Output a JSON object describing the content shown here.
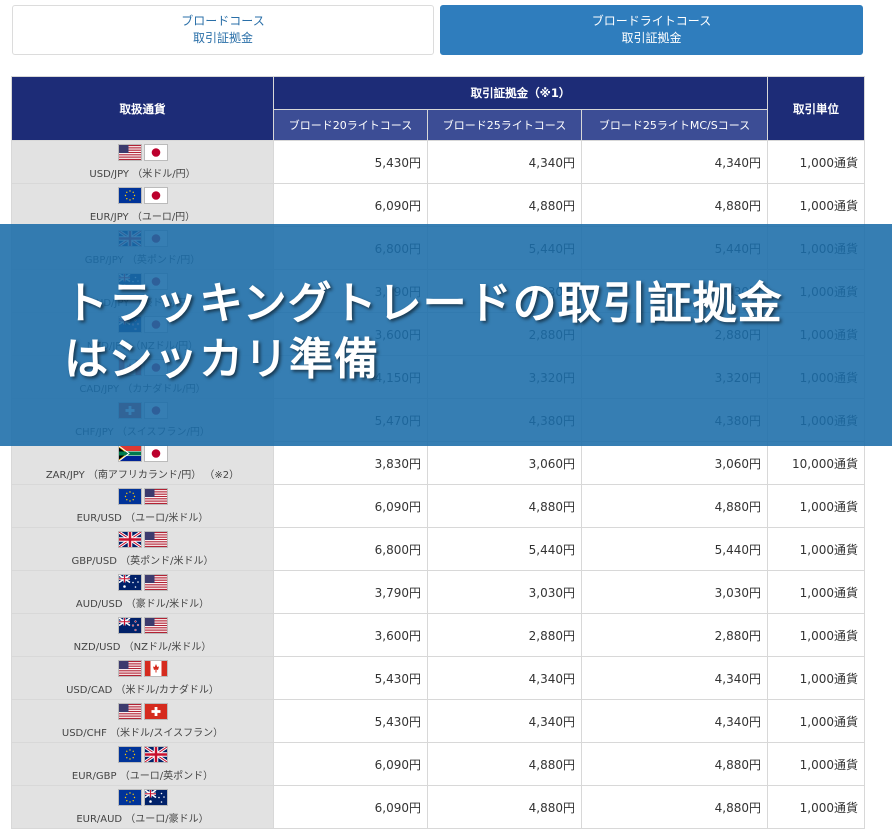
{
  "tabs": [
    {
      "line1": "ブロードコース",
      "line2": "取引証拠金",
      "active": false
    },
    {
      "line1": "ブロードライトコース",
      "line2": "取引証拠金",
      "active": true
    }
  ],
  "table": {
    "col_pair": "取扱通貨",
    "col_margin": "取引証拠金（※1）",
    "col_unit": "取引単位",
    "sub_cols": [
      "ブロード20ライトコース",
      "ブロード25ライトコース",
      "ブロード25ライトMC/Sコース"
    ],
    "rows": [
      {
        "flags": [
          "us",
          "jp"
        ],
        "label": "USD/JPY （米ドル/円）",
        "v1": "5,430円",
        "v2": "4,340円",
        "v3": "4,340円",
        "unit": "1,000通貨"
      },
      {
        "flags": [
          "eu",
          "jp"
        ],
        "label": "EUR/JPY （ユーロ/円）",
        "v1": "6,090円",
        "v2": "4,880円",
        "v3": "4,880円",
        "unit": "1,000通貨"
      },
      {
        "flags": [
          "gb",
          "jp"
        ],
        "label": "GBP/JPY （英ポンド/円）",
        "v1": "6,800円",
        "v2": "5,440円",
        "v3": "5,440円",
        "unit": "1,000通貨"
      },
      {
        "flags": [
          "au",
          "jp"
        ],
        "label": "AUD/JPY （豪ドル/円）",
        "v1": "3,790円",
        "v2": "3,030円",
        "v3": "3,030円",
        "unit": "1,000通貨"
      },
      {
        "flags": [
          "nz",
          "jp"
        ],
        "label": "NZD/JPY （NZドル/円）",
        "v1": "3,600円",
        "v2": "2,880円",
        "v3": "2,880円",
        "unit": "1,000通貨"
      },
      {
        "flags": [
          "ca",
          "jp"
        ],
        "label": "CAD/JPY （カナダドル/円）",
        "v1": "4,150円",
        "v2": "3,320円",
        "v3": "3,320円",
        "unit": "1,000通貨"
      },
      {
        "flags": [
          "ch",
          "jp"
        ],
        "label": "CHF/JPY （スイスフラン/円）",
        "v1": "5,470円",
        "v2": "4,380円",
        "v3": "4,380円",
        "unit": "1,000通貨"
      },
      {
        "flags": [
          "za",
          "jp"
        ],
        "label": "ZAR/JPY （南アフリカランド/円） （※2）",
        "v1": "3,830円",
        "v2": "3,060円",
        "v3": "3,060円",
        "unit": "10,000通貨"
      },
      {
        "flags": [
          "eu",
          "us"
        ],
        "label": "EUR/USD （ユーロ/米ドル）",
        "v1": "6,090円",
        "v2": "4,880円",
        "v3": "4,880円",
        "unit": "1,000通貨"
      },
      {
        "flags": [
          "gb",
          "us"
        ],
        "label": "GBP/USD （英ポンド/米ドル）",
        "v1": "6,800円",
        "v2": "5,440円",
        "v3": "5,440円",
        "unit": "1,000通貨"
      },
      {
        "flags": [
          "au",
          "us"
        ],
        "label": "AUD/USD （豪ドル/米ドル）",
        "v1": "3,790円",
        "v2": "3,030円",
        "v3": "3,030円",
        "unit": "1,000通貨"
      },
      {
        "flags": [
          "nz",
          "us"
        ],
        "label": "NZD/USD （NZドル/米ドル）",
        "v1": "3,600円",
        "v2": "2,880円",
        "v3": "2,880円",
        "unit": "1,000通貨"
      },
      {
        "flags": [
          "us",
          "ca"
        ],
        "label": "USD/CAD （米ドル/カナダドル）",
        "v1": "5,430円",
        "v2": "4,340円",
        "v3": "4,340円",
        "unit": "1,000通貨"
      },
      {
        "flags": [
          "us",
          "ch"
        ],
        "label": "USD/CHF （米ドル/スイスフラン）",
        "v1": "5,430円",
        "v2": "4,340円",
        "v3": "4,340円",
        "unit": "1,000通貨"
      },
      {
        "flags": [
          "eu",
          "gb"
        ],
        "label": "EUR/GBP （ユーロ/英ポンド）",
        "v1": "6,090円",
        "v2": "4,880円",
        "v3": "4,880円",
        "unit": "1,000通貨"
      },
      {
        "flags": [
          "eu",
          "au"
        ],
        "label": "EUR/AUD （ユーロ/豪ドル）",
        "v1": "6,090円",
        "v2": "4,880円",
        "v3": "4,880円",
        "unit": "1,000通貨"
      }
    ]
  },
  "banner": {
    "line1": "トラッキングトレードの取引証拠金",
    "line2": "はシッカリ準備"
  },
  "colors": {
    "header_dark": "#1d2c77",
    "header_sub": "#3c4d95",
    "tab_active": "#2f7dbd",
    "banner": "#1a6ca8"
  }
}
